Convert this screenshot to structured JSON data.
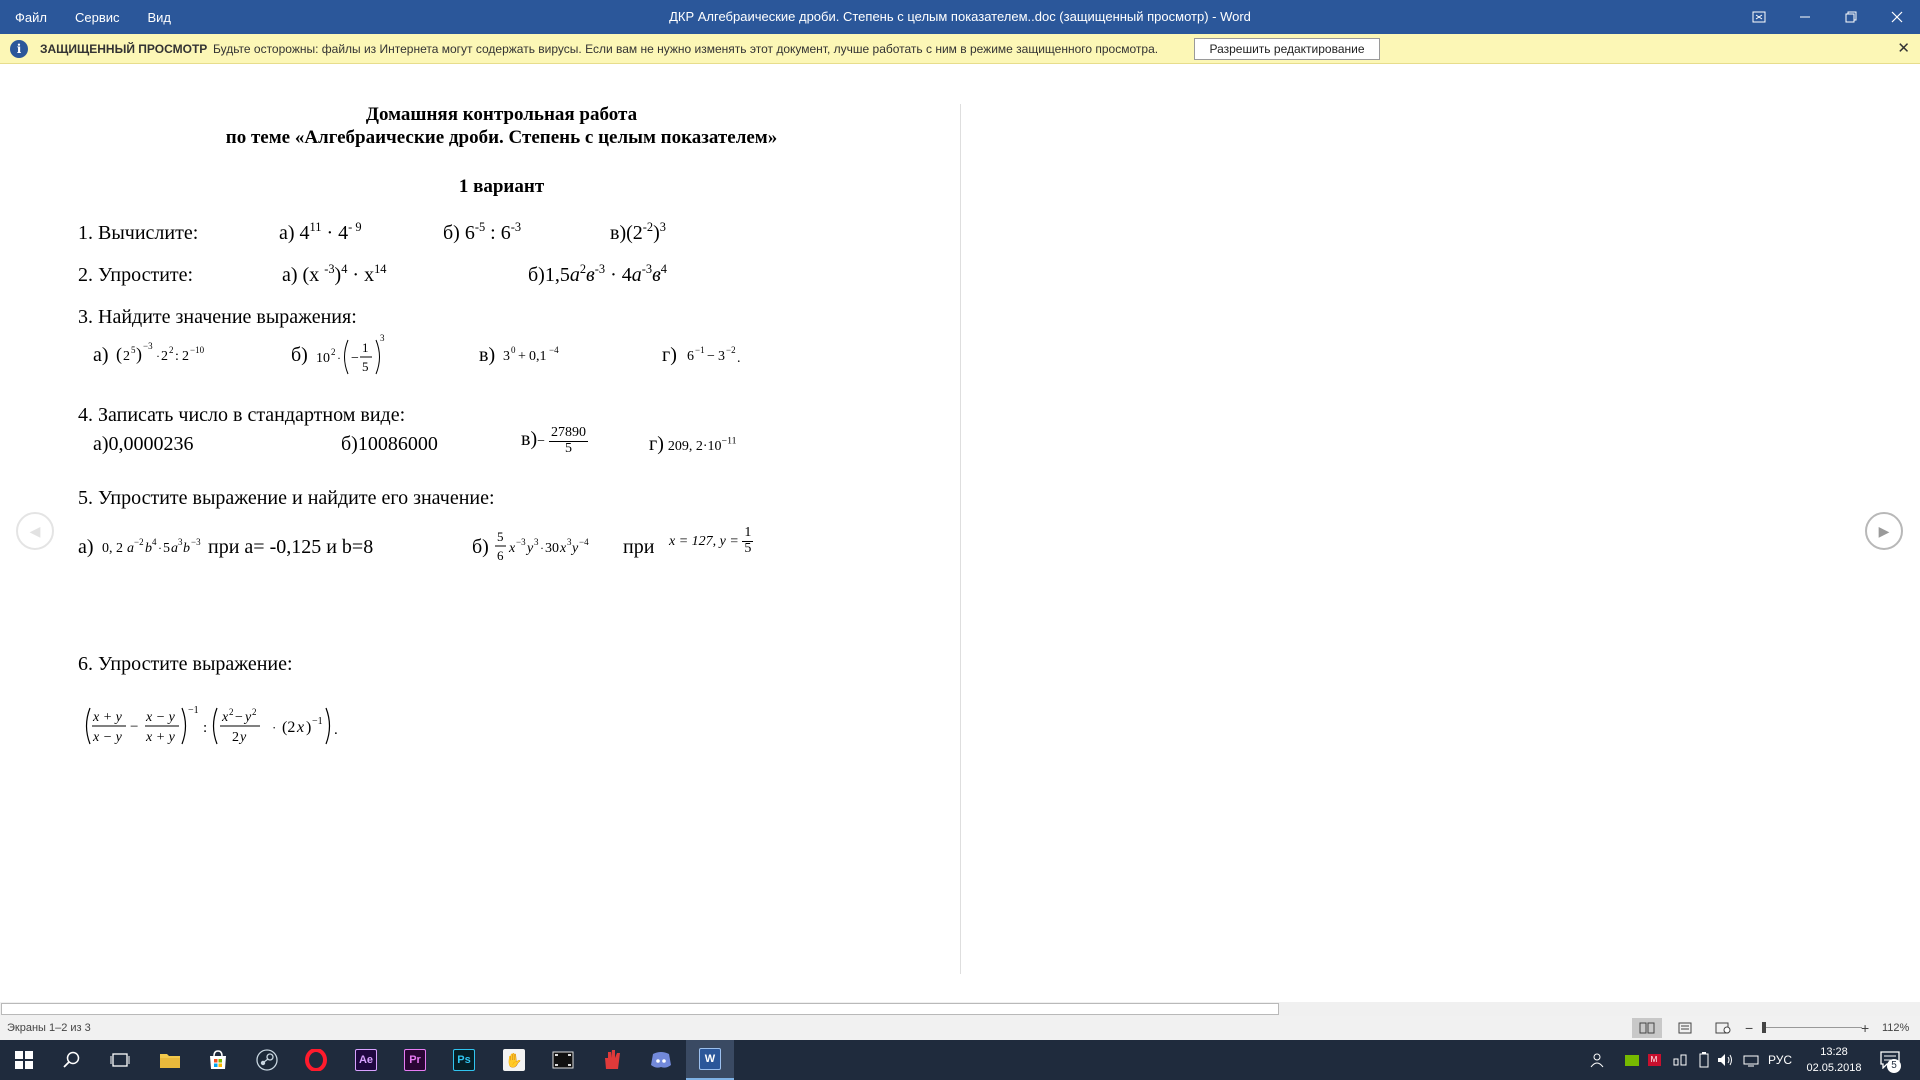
{
  "window": {
    "menu": [
      "Файл",
      "Сервис",
      "Вид"
    ],
    "title": "ДКР Алгебраические дроби. Степень с целым показателем..doc (защищенный просмотр) - Word"
  },
  "protected_view": {
    "title": "ЗАЩИЩЕННЫЙ ПРОСМОТР",
    "message": "Будьте осторожны: файлы из Интернета могут содержать вирусы. Если вам не нужно изменять этот документ, лучше работать с ним в режиме защищенного просмотра.",
    "enable_button": "Разрешить редактирование"
  },
  "document": {
    "heading1": "Домашняя контрольная работа",
    "heading2": "по теме «Алгебраические дроби. Степень с целым показателем»",
    "variant": "1 вариант",
    "task1": {
      "label": "1. Вычислите:",
      "a_prefix": "а) ",
      "a_base1": "4",
      "a_exp1": "11",
      "a_op": " · ",
      "a_base2": "4",
      "a_exp2": "- 9",
      "b_prefix": "б) ",
      "b_base1": "6",
      "b_exp1": "-5",
      "b_op": " : ",
      "b_base2": "6",
      "b_exp2": "-3",
      "v_prefix": "в)(",
      "v_base": "2",
      "v_exp_in": "-2",
      "v_close": ")",
      "v_exp_out": "3"
    },
    "task2": {
      "label": "2.  Упростите:",
      "a_prefix": "а) (x ",
      "a_exp_in": "-3",
      "a_close": ")",
      "a_exp_out": "4",
      "a_op": " · x",
      "a_exp2": "14",
      "b_prefix": "б)1,5",
      "b_t1": "а",
      "b_e1": "2",
      "b_t2": "в",
      "b_e2": "-3",
      "b_op": " · 4",
      "b_t3": "а",
      "b_e3": "-3",
      "b_t4": "в",
      "b_e4": "4"
    },
    "task3": {
      "label": "3.  Найдите значение выражения:",
      "a_prefix": "а)",
      "b_prefix": "б)",
      "v_prefix": "в)",
      "g_prefix": "г)"
    },
    "task4": {
      "label": "4. Записать число в стандартном виде:",
      "a": "а)0,0000236",
      "b": "б)10086000",
      "v_prefix": "в)",
      "v_minus": "−",
      "v_num": "27890",
      "v_den": "5",
      "g_prefix": "г)",
      "g_expr": "209, 2·10",
      "g_exp": "−11"
    },
    "task5": {
      "label": "5.  Упростите выражение   и найдите его значение:",
      "a_prefix": "а)",
      "a_cond": " при а= -0,125 и b=8",
      "b_prefix": "б)",
      "b_cond": "при",
      "b_vals": "x = 127, y = ",
      "b_frac_num": "1",
      "b_frac_den": "5"
    },
    "task6": {
      "label": "6. Упростите выражение:"
    }
  },
  "statusbar": {
    "pages": "Экраны 1–2 из 3",
    "zoom": "112%"
  },
  "taskbar": {
    "apps": [
      "Ae",
      "Pr",
      "Ps"
    ],
    "word_tile": "W",
    "language": "РУС",
    "time": "13:28",
    "date": "02.05.2018",
    "notifications": "5"
  }
}
